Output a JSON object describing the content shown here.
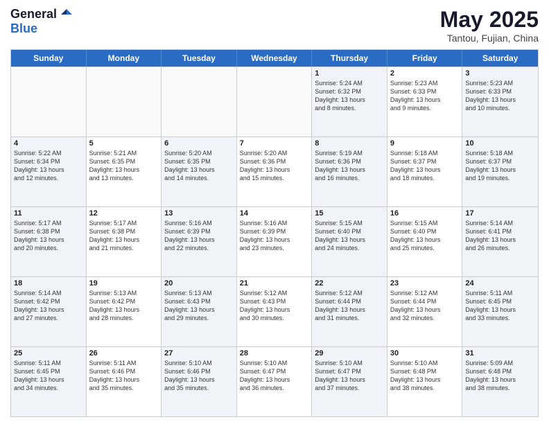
{
  "header": {
    "logo_general": "General",
    "logo_blue": "Blue",
    "month": "May 2025",
    "location": "Tantou, Fujian, China"
  },
  "days_of_week": [
    "Sunday",
    "Monday",
    "Tuesday",
    "Wednesday",
    "Thursday",
    "Friday",
    "Saturday"
  ],
  "weeks": [
    [
      {
        "day": "",
        "info": ""
      },
      {
        "day": "",
        "info": ""
      },
      {
        "day": "",
        "info": ""
      },
      {
        "day": "",
        "info": ""
      },
      {
        "day": "1",
        "info": "Sunrise: 5:24 AM\nSunset: 6:32 PM\nDaylight: 13 hours\nand 8 minutes."
      },
      {
        "day": "2",
        "info": "Sunrise: 5:23 AM\nSunset: 6:33 PM\nDaylight: 13 hours\nand 9 minutes."
      },
      {
        "day": "3",
        "info": "Sunrise: 5:23 AM\nSunset: 6:33 PM\nDaylight: 13 hours\nand 10 minutes."
      }
    ],
    [
      {
        "day": "4",
        "info": "Sunrise: 5:22 AM\nSunset: 6:34 PM\nDaylight: 13 hours\nand 12 minutes."
      },
      {
        "day": "5",
        "info": "Sunrise: 5:21 AM\nSunset: 6:35 PM\nDaylight: 13 hours\nand 13 minutes."
      },
      {
        "day": "6",
        "info": "Sunrise: 5:20 AM\nSunset: 6:35 PM\nDaylight: 13 hours\nand 14 minutes."
      },
      {
        "day": "7",
        "info": "Sunrise: 5:20 AM\nSunset: 6:36 PM\nDaylight: 13 hours\nand 15 minutes."
      },
      {
        "day": "8",
        "info": "Sunrise: 5:19 AM\nSunset: 6:36 PM\nDaylight: 13 hours\nand 16 minutes."
      },
      {
        "day": "9",
        "info": "Sunrise: 5:18 AM\nSunset: 6:37 PM\nDaylight: 13 hours\nand 18 minutes."
      },
      {
        "day": "10",
        "info": "Sunrise: 5:18 AM\nSunset: 6:37 PM\nDaylight: 13 hours\nand 19 minutes."
      }
    ],
    [
      {
        "day": "11",
        "info": "Sunrise: 5:17 AM\nSunset: 6:38 PM\nDaylight: 13 hours\nand 20 minutes."
      },
      {
        "day": "12",
        "info": "Sunrise: 5:17 AM\nSunset: 6:38 PM\nDaylight: 13 hours\nand 21 minutes."
      },
      {
        "day": "13",
        "info": "Sunrise: 5:16 AM\nSunset: 6:39 PM\nDaylight: 13 hours\nand 22 minutes."
      },
      {
        "day": "14",
        "info": "Sunrise: 5:16 AM\nSunset: 6:39 PM\nDaylight: 13 hours\nand 23 minutes."
      },
      {
        "day": "15",
        "info": "Sunrise: 5:15 AM\nSunset: 6:40 PM\nDaylight: 13 hours\nand 24 minutes."
      },
      {
        "day": "16",
        "info": "Sunrise: 5:15 AM\nSunset: 6:40 PM\nDaylight: 13 hours\nand 25 minutes."
      },
      {
        "day": "17",
        "info": "Sunrise: 5:14 AM\nSunset: 6:41 PM\nDaylight: 13 hours\nand 26 minutes."
      }
    ],
    [
      {
        "day": "18",
        "info": "Sunrise: 5:14 AM\nSunset: 6:42 PM\nDaylight: 13 hours\nand 27 minutes."
      },
      {
        "day": "19",
        "info": "Sunrise: 5:13 AM\nSunset: 6:42 PM\nDaylight: 13 hours\nand 28 minutes."
      },
      {
        "day": "20",
        "info": "Sunrise: 5:13 AM\nSunset: 6:43 PM\nDaylight: 13 hours\nand 29 minutes."
      },
      {
        "day": "21",
        "info": "Sunrise: 5:12 AM\nSunset: 6:43 PM\nDaylight: 13 hours\nand 30 minutes."
      },
      {
        "day": "22",
        "info": "Sunrise: 5:12 AM\nSunset: 6:44 PM\nDaylight: 13 hours\nand 31 minutes."
      },
      {
        "day": "23",
        "info": "Sunrise: 5:12 AM\nSunset: 6:44 PM\nDaylight: 13 hours\nand 32 minutes."
      },
      {
        "day": "24",
        "info": "Sunrise: 5:11 AM\nSunset: 6:45 PM\nDaylight: 13 hours\nand 33 minutes."
      }
    ],
    [
      {
        "day": "25",
        "info": "Sunrise: 5:11 AM\nSunset: 6:45 PM\nDaylight: 13 hours\nand 34 minutes."
      },
      {
        "day": "26",
        "info": "Sunrise: 5:11 AM\nSunset: 6:46 PM\nDaylight: 13 hours\nand 35 minutes."
      },
      {
        "day": "27",
        "info": "Sunrise: 5:10 AM\nSunset: 6:46 PM\nDaylight: 13 hours\nand 35 minutes."
      },
      {
        "day": "28",
        "info": "Sunrise: 5:10 AM\nSunset: 6:47 PM\nDaylight: 13 hours\nand 36 minutes."
      },
      {
        "day": "29",
        "info": "Sunrise: 5:10 AM\nSunset: 6:47 PM\nDaylight: 13 hours\nand 37 minutes."
      },
      {
        "day": "30",
        "info": "Sunrise: 5:10 AM\nSunset: 6:48 PM\nDaylight: 13 hours\nand 38 minutes."
      },
      {
        "day": "31",
        "info": "Sunrise: 5:09 AM\nSunset: 6:48 PM\nDaylight: 13 hours\nand 38 minutes."
      }
    ]
  ]
}
